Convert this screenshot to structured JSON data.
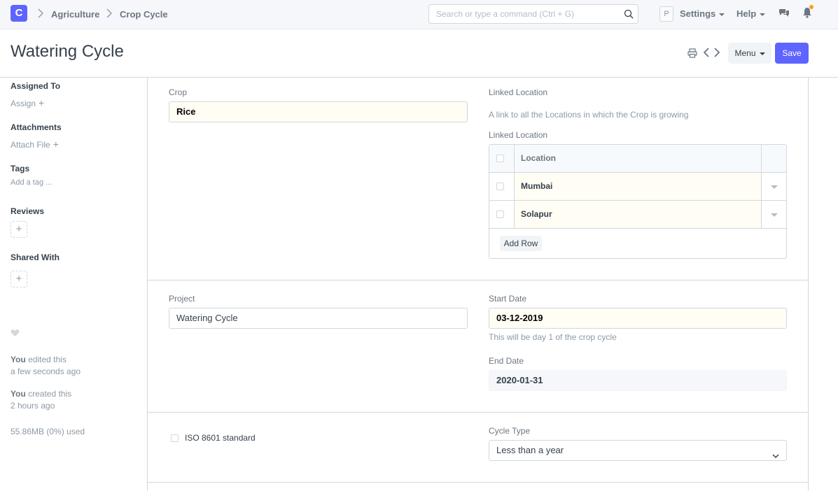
{
  "navbar": {
    "logo_letter": "C",
    "breadcrumbs": [
      "Agriculture",
      "Crop Cycle"
    ],
    "search_placeholder": "Search or type a command (Ctrl + G)",
    "avatar_letter": "P",
    "settings_label": "Settings",
    "help_label": "Help"
  },
  "page": {
    "title": "Watering Cycle",
    "menu_label": "Menu",
    "save_label": "Save"
  },
  "sidebar": {
    "assigned_to_label": "Assigned To",
    "assign_label": "Assign",
    "attachments_label": "Attachments",
    "attach_label": "Attach File",
    "tags_label": "Tags",
    "add_tag_label": "Add a tag ...",
    "reviews_label": "Reviews",
    "shared_with_label": "Shared With",
    "activity": [
      {
        "who": "You",
        "what": " edited this",
        "when": "a few seconds ago"
      },
      {
        "who": "You",
        "what": " created this",
        "when": "2 hours ago"
      }
    ],
    "storage": "55.86MB (0%) used"
  },
  "form": {
    "crop_label": "Crop",
    "crop_value": "Rice",
    "linked_location_label": "Linked Location",
    "linked_location_help": "A link to all the Locations in which the Crop is growing",
    "linked_location_table_label": "Linked Location",
    "table_header": "Location",
    "table_rows": [
      "Mumbai",
      "Solapur"
    ],
    "add_row_label": "Add Row",
    "project_label": "Project",
    "project_value": "Watering Cycle",
    "start_date_label": "Start Date",
    "start_date_value": "03-12-2019",
    "start_date_help": "This will be day 1 of the crop cycle",
    "end_date_label": "End Date",
    "end_date_value": "2020-01-31",
    "iso_label": "ISO 8601 standard",
    "cycle_type_label": "Cycle Type",
    "cycle_type_value": "Less than a year"
  },
  "colors": {
    "primary": "#5e64ff",
    "mandatory_bg": "#fffdf4",
    "notification_dot": "#ff9f1c"
  }
}
